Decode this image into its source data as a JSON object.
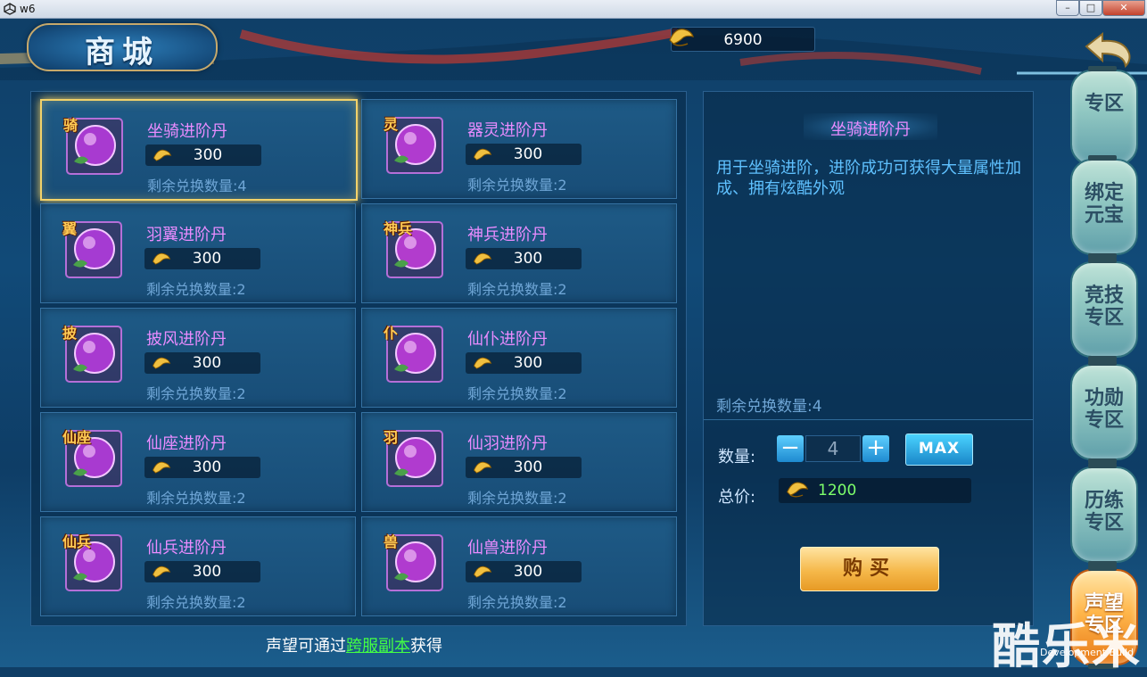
{
  "window": {
    "title": "w6",
    "min_label": "–",
    "max_label": "□",
    "close_label": "✕"
  },
  "header": {
    "title": "商城",
    "currency_value": "6900"
  },
  "items": [
    {
      "tag": "骑",
      "name": "坐骑进阶丹",
      "price": "300",
      "remain": "剩余兑换数量:4",
      "orb": "#a83ad0"
    },
    {
      "tag": "灵",
      "name": "器灵进阶丹",
      "price": "300",
      "remain": "剩余兑换数量:2",
      "orb": "#b03bcf"
    },
    {
      "tag": "翼",
      "name": "羽翼进阶丹",
      "price": "300",
      "remain": "剩余兑换数量:2",
      "orb": "#a53bd2"
    },
    {
      "tag": "神兵",
      "name": "神兵进阶丹",
      "price": "300",
      "remain": "剩余兑换数量:2",
      "orb": "#b23ccd"
    },
    {
      "tag": "披",
      "name": "披风进阶丹",
      "price": "300",
      "remain": "剩余兑换数量:2",
      "orb": "#a83ad0"
    },
    {
      "tag": "仆",
      "name": "仙仆进阶丹",
      "price": "300",
      "remain": "剩余兑换数量:2",
      "orb": "#b03bcf"
    },
    {
      "tag": "仙座",
      "name": "仙座进阶丹",
      "price": "300",
      "remain": "剩余兑换数量:2",
      "orb": "#a83ad0"
    },
    {
      "tag": "羽",
      "name": "仙羽进阶丹",
      "price": "300",
      "remain": "剩余兑换数量:2",
      "orb": "#b03bcf"
    },
    {
      "tag": "仙兵",
      "name": "仙兵进阶丹",
      "price": "300",
      "remain": "剩余兑换数量:2",
      "orb": "#a83ad0"
    },
    {
      "tag": "兽",
      "name": "仙兽进阶丹",
      "price": "300",
      "remain": "剩余兑换数量:2",
      "orb": "#b03bcf"
    }
  ],
  "detail": {
    "title": "坐骑进阶丹",
    "description": "用于坐骑进阶，进阶成功可获得大量属性加成、拥有炫酷外观",
    "remain": "剩余兑换数量:4",
    "quantity_label": "数量:",
    "quantity": "4",
    "minus_label": "−",
    "plus_label": "+",
    "max_label": "MAX",
    "total_label": "总价:",
    "total_value": "1200",
    "buy_label": "购买"
  },
  "tabs": [
    {
      "label": "专区",
      "active": false
    },
    {
      "label": "绑定\n元宝",
      "active": false
    },
    {
      "label": "竞技\n专区",
      "active": false
    },
    {
      "label": "功勋\n专区",
      "active": false
    },
    {
      "label": "历练\n专区",
      "active": false
    },
    {
      "label": "声望\n专区",
      "active": true
    }
  ],
  "footer": {
    "prefix": "声望可通过",
    "link": "跨服副本",
    "suffix": "获得"
  },
  "watermark": "酷乐米",
  "build_label": "Development Build",
  "colors": {
    "accent_gold": "#f2d26a",
    "item_name": "#e98cff",
    "link_green": "#44ff44"
  }
}
